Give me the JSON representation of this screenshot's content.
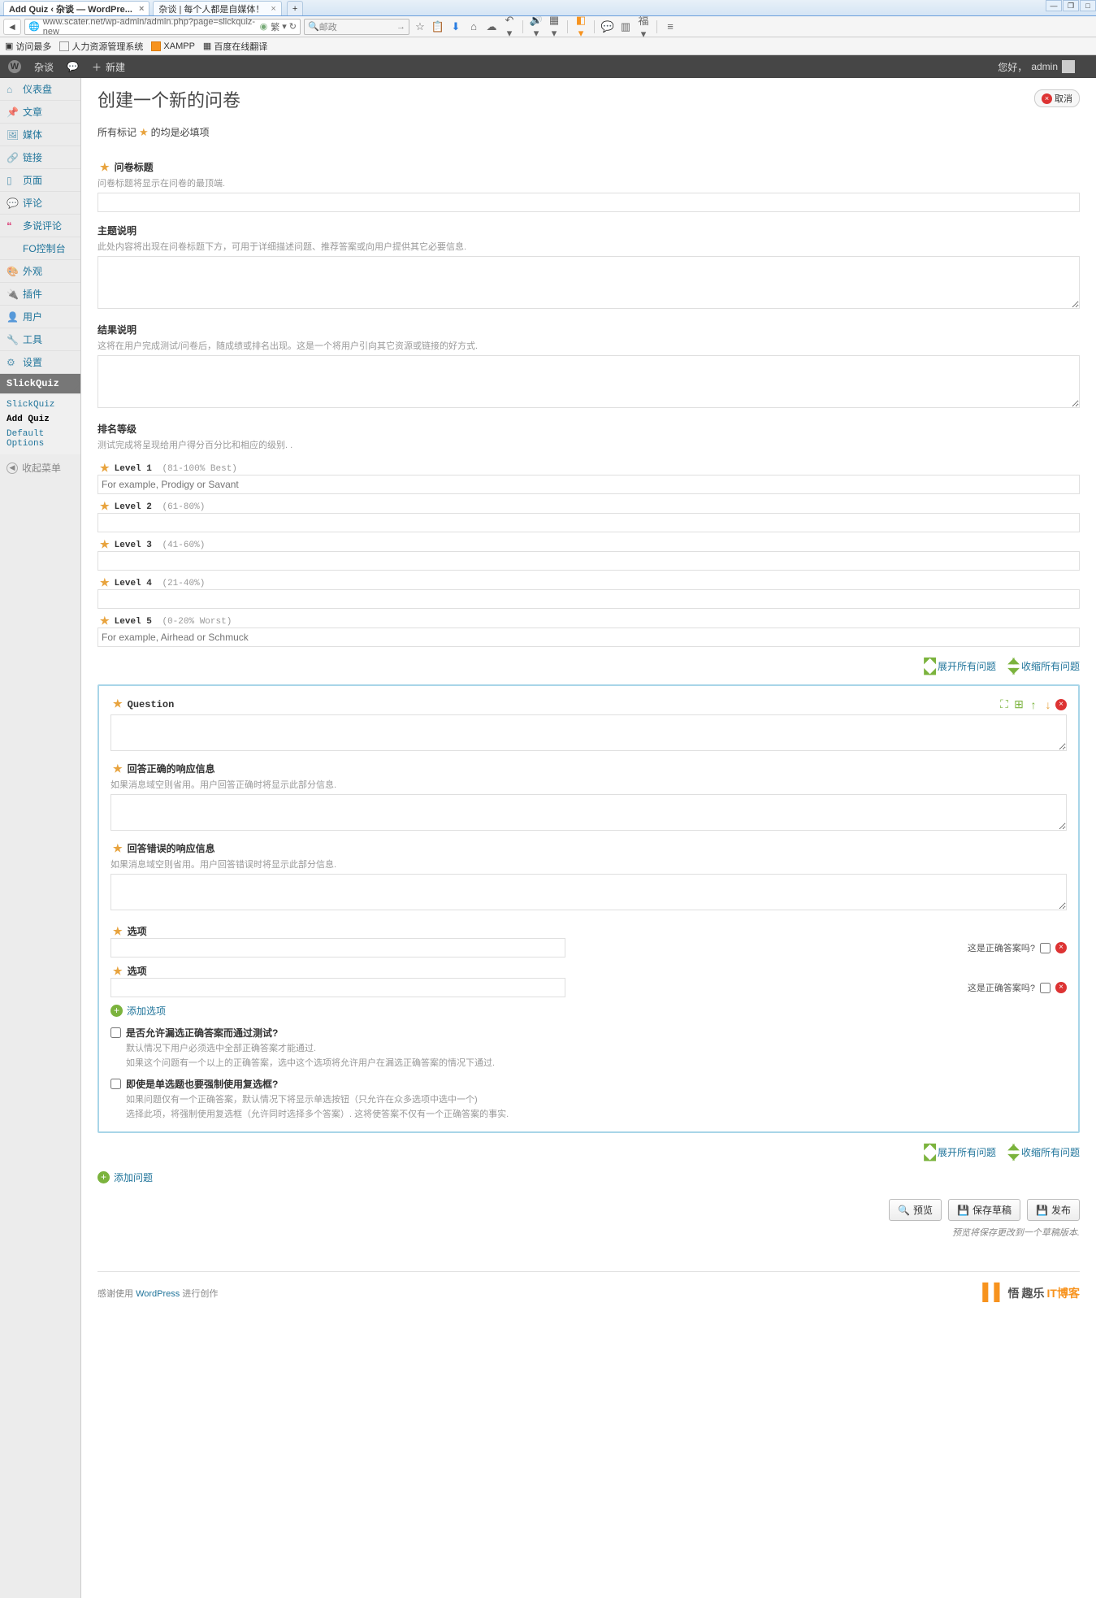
{
  "browser": {
    "tabs": [
      {
        "title": "Add Quiz ‹ 杂谈 — WordPre..."
      },
      {
        "title": "杂谈 | 每个人都是自媒体！"
      }
    ],
    "url": "www.scater.net/wp-admin/admin.php?page=slickquiz-new",
    "search_engine": "邮政",
    "bookmarks": {
      "most": "访问最多",
      "hr": "人力资源管理系统",
      "xampp": "XAMPP",
      "baidu": "百度在线翻译"
    }
  },
  "adminbar": {
    "site": "杂谈",
    "new": "新建",
    "greeting": "您好，",
    "user": "admin"
  },
  "sidebar": {
    "items": [
      {
        "label": "仪表盘"
      },
      {
        "label": "文章"
      },
      {
        "label": "媒体"
      },
      {
        "label": "链接"
      },
      {
        "label": "页面"
      },
      {
        "label": "评论"
      },
      {
        "label": "多说评论"
      },
      {
        "label": "FO控制台"
      },
      {
        "label": "外观"
      },
      {
        "label": "插件"
      },
      {
        "label": "用户"
      },
      {
        "label": "工具"
      },
      {
        "label": "设置"
      }
    ],
    "slick": "SlickQuiz",
    "sub": {
      "list": "SlickQuiz",
      "add": "Add Quiz",
      "def": "Default Options"
    },
    "collapse": "收起菜单"
  },
  "page": {
    "title": "创建一个新的问卷",
    "cancel": "取消",
    "req1": "所有标记",
    "req2": "的均是必填项",
    "f_title": {
      "label": "问卷标题",
      "desc": "问卷标题将显示在问卷的最顶端."
    },
    "f_main": {
      "label": "主题说明",
      "desc": "此处内容将出现在问卷标题下方，可用于详细描述问题、推荐答案或向用户提供其它必要信息."
    },
    "f_result": {
      "label": "结果说明",
      "desc": "这将在用户完成测试/问卷后，随成绩或排名出现。这是一个将用户引向其它资源或链接的好方式."
    },
    "rank": {
      "label": "排名等级",
      "desc": "测试完成将呈现给用户得分百分比和相应的级别. ."
    },
    "lvl": [
      {
        "name": "Level 1",
        "range": "(81-100% Best)",
        "ph": "For example, Prodigy or Savant"
      },
      {
        "name": "Level 2",
        "range": "(61-80%)",
        "ph": ""
      },
      {
        "name": "Level 3",
        "range": "(41-60%)",
        "ph": ""
      },
      {
        "name": "Level 4",
        "range": "(21-40%)",
        "ph": ""
      },
      {
        "name": "Level 5",
        "range": "(0-20% Worst)",
        "ph": "For example, Airhead or Schmuck"
      }
    ],
    "expand": "展开所有问题",
    "collapse_q": "收缩所有问题",
    "q": {
      "label": "Question",
      "correct": {
        "label": "回答正确的响应信息",
        "desc": "如果消息域空则省用。用户回答正确时将显示此部分信息."
      },
      "wrong": {
        "label": "回答错误的响应信息",
        "desc": "如果消息域空则省用。用户回答错误时将显示此部分信息."
      },
      "option": "选项",
      "is_correct": "这是正确答案吗?",
      "add_opt": "添加选项",
      "allow_partial": {
        "t": "是否允许漏选正确答案而通过测试?",
        "d1": "默认情况下用户必须选中全部正确答案才能通过.",
        "d2": "如果这个问题有一个以上的正确答案，选中这个选项将允许用户在漏选正确答案的情况下通过."
      },
      "force_multi": {
        "t": "即使是单选题也要强制使用复选框?",
        "d1": "如果问题仅有一个正确答案，默认情况下将显示单选按钮（只允许在众多选项中选中一个)",
        "d2": "选择此项，将强制使用复选框（允许同时选择多个答案）. 这将使答案不仅有一个正确答案的事实."
      }
    },
    "add_q": "添加问题",
    "btn": {
      "preview": "预览",
      "draft": "保存草稿",
      "publish": "发布"
    },
    "save_note": "预览将保存更改到一个草稿版本.",
    "footer": {
      "thank": "感谢使用 ",
      "wp": "WordPress",
      "create": " 进行创作",
      "blog1": "悟",
      "blog2": "趣乐",
      "blog3": "IT博客"
    }
  }
}
